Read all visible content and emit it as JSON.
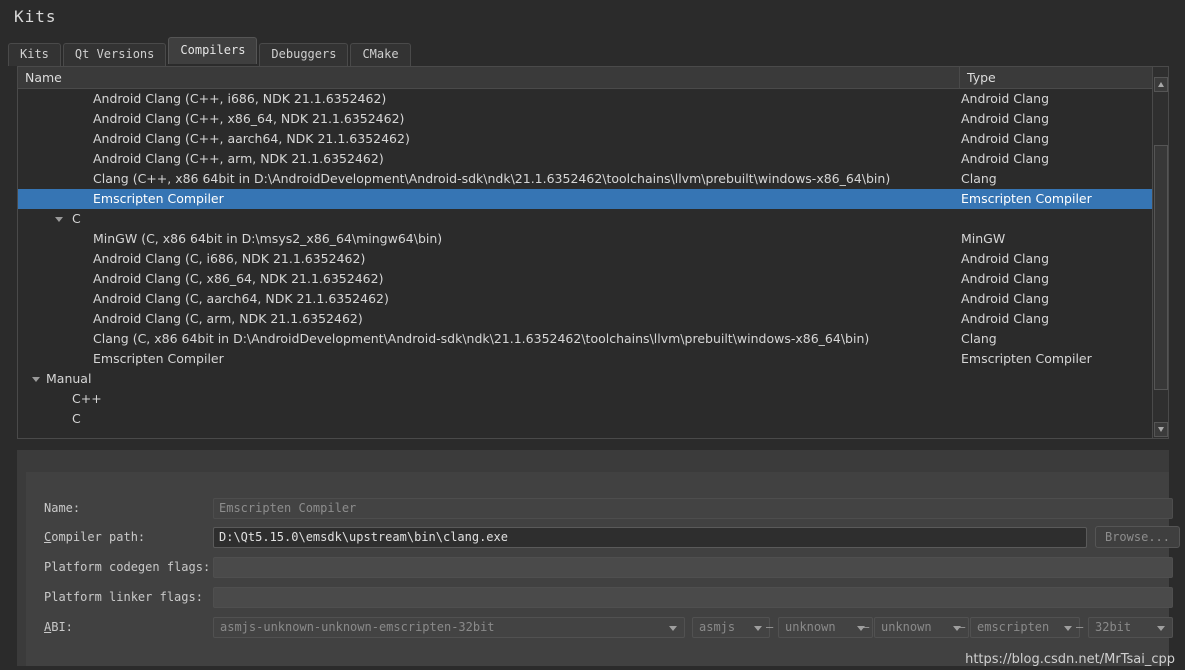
{
  "window": {
    "title": "Kits"
  },
  "tabs": [
    {
      "label": "Kits",
      "active": false
    },
    {
      "label": "Qt Versions",
      "active": false
    },
    {
      "label": "Compilers",
      "active": true
    },
    {
      "label": "Debuggers",
      "active": false
    },
    {
      "label": "CMake",
      "active": false
    }
  ],
  "tree": {
    "columns": {
      "name": "Name",
      "type": "Type"
    },
    "rows": [
      {
        "depth": 2,
        "name": "Android Clang (C++, i686, NDK 21.1.6352462)",
        "type": "Android Clang",
        "arrow": false,
        "selected": false
      },
      {
        "depth": 2,
        "name": "Android Clang (C++, x86_64, NDK 21.1.6352462)",
        "type": "Android Clang",
        "arrow": false,
        "selected": false
      },
      {
        "depth": 2,
        "name": "Android Clang (C++, aarch64, NDK 21.1.6352462)",
        "type": "Android Clang",
        "arrow": false,
        "selected": false
      },
      {
        "depth": 2,
        "name": "Android Clang (C++, arm, NDK 21.1.6352462)",
        "type": "Android Clang",
        "arrow": false,
        "selected": false
      },
      {
        "depth": 2,
        "name": "Clang (C++, x86 64bit in D:\\AndroidDevelopment\\Android-sdk\\ndk\\21.1.6352462\\toolchains\\llvm\\prebuilt\\windows-x86_64\\bin)",
        "type": "Clang",
        "arrow": false,
        "selected": false
      },
      {
        "depth": 2,
        "name": "Emscripten Compiler",
        "type": "Emscripten Compiler",
        "arrow": false,
        "selected": true
      },
      {
        "depth": 1,
        "name": "C",
        "type": "",
        "arrow": true,
        "selected": false
      },
      {
        "depth": 2,
        "name": "MinGW (C, x86 64bit in D:\\msys2_x86_64\\mingw64\\bin)",
        "type": "MinGW",
        "arrow": false,
        "selected": false
      },
      {
        "depth": 2,
        "name": "Android Clang (C, i686, NDK 21.1.6352462)",
        "type": "Android Clang",
        "arrow": false,
        "selected": false
      },
      {
        "depth": 2,
        "name": "Android Clang (C, x86_64, NDK 21.1.6352462)",
        "type": "Android Clang",
        "arrow": false,
        "selected": false
      },
      {
        "depth": 2,
        "name": "Android Clang (C, aarch64, NDK 21.1.6352462)",
        "type": "Android Clang",
        "arrow": false,
        "selected": false
      },
      {
        "depth": 2,
        "name": "Android Clang (C, arm, NDK 21.1.6352462)",
        "type": "Android Clang",
        "arrow": false,
        "selected": false
      },
      {
        "depth": 2,
        "name": "Clang (C, x86 64bit in D:\\AndroidDevelopment\\Android-sdk\\ndk\\21.1.6352462\\toolchains\\llvm\\prebuilt\\windows-x86_64\\bin)",
        "type": "Clang",
        "arrow": false,
        "selected": false
      },
      {
        "depth": 2,
        "name": "Emscripten Compiler",
        "type": "Emscripten Compiler",
        "arrow": false,
        "selected": false
      },
      {
        "depth": 0,
        "name": "Manual",
        "type": "",
        "arrow": true,
        "selected": false
      },
      {
        "depth": 1,
        "name": "C++",
        "type": "",
        "arrow": false,
        "selected": false
      },
      {
        "depth": 1,
        "name": "C",
        "type": "",
        "arrow": false,
        "selected": false
      }
    ]
  },
  "form": {
    "name": {
      "label": "Name:",
      "value": "Emscripten Compiler"
    },
    "compiler_path": {
      "label_pre": "",
      "label_mn": "C",
      "label_post": "ompiler path:",
      "value": "D:\\Qt5.15.0\\emsdk\\upstream\\bin\\clang.exe",
      "browse": "Browse..."
    },
    "codegen": {
      "label": "Platform codegen flags:",
      "value": ""
    },
    "linker": {
      "label": "Platform linker flags:",
      "value": ""
    },
    "abi": {
      "label_mn": "A",
      "label_post": "BI:",
      "value": "asmjs-unknown-unknown-emscripten-32bit",
      "parts": [
        "asmjs",
        "unknown",
        "unknown",
        "emscripten",
        "32bit"
      ],
      "separator": "–"
    }
  },
  "watermark": {
    "text": "https://blog.csdn.net/MrTsai_cpp"
  },
  "colors": {
    "selection": "#3675b4",
    "window_bg": "#2b2b2b",
    "panel_bg": "#3b3b3b"
  }
}
